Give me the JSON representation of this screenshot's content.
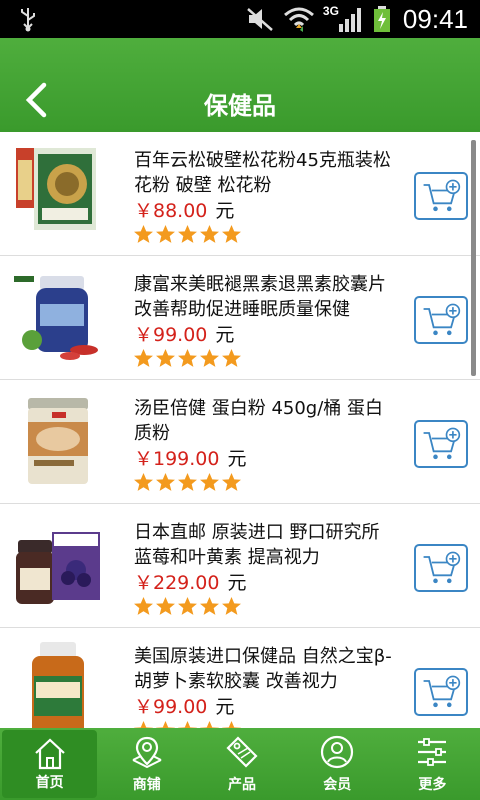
{
  "status_bar": {
    "time": "09:41",
    "network": "3G"
  },
  "header": {
    "title": "保健品"
  },
  "products": [
    {
      "name": "百年云松破壁松花粉45克瓶装松花粉 破壁 松花粉",
      "price": "￥88.00",
      "unit": "元",
      "rating": 5
    },
    {
      "name": "康富来美眠褪黑素退黑素胶囊片改善帮助促进睡眠质量保健",
      "price": "￥99.00",
      "unit": "元",
      "rating": 5
    },
    {
      "name": "汤臣倍健 蛋白粉 450g/桶 蛋白质粉",
      "price": "￥199.00",
      "unit": "元",
      "rating": 5
    },
    {
      "name": "日本直邮 原装进口 野口研究所蓝莓和叶黄素 提高视力",
      "price": "￥229.00",
      "unit": "元",
      "rating": 5
    },
    {
      "name": "美国原装进口保健品 自然之宝β-胡萝卜素软胶囊 改善视力",
      "price": "￥99.00",
      "unit": "元",
      "rating": 5
    }
  ],
  "tabs": [
    {
      "label": "首页",
      "icon": "home-icon",
      "active": true
    },
    {
      "label": "商铺",
      "icon": "shop-icon",
      "active": false
    },
    {
      "label": "产品",
      "icon": "sale-tag-icon",
      "active": false
    },
    {
      "label": "会员",
      "icon": "member-icon",
      "active": false
    },
    {
      "label": "更多",
      "icon": "more-settings-icon",
      "active": false
    }
  ],
  "colors": {
    "header_green": "#4fae3d",
    "price_red": "#d4221b",
    "cart_blue": "#3b86c4",
    "star_orange": "#f39a1e"
  }
}
